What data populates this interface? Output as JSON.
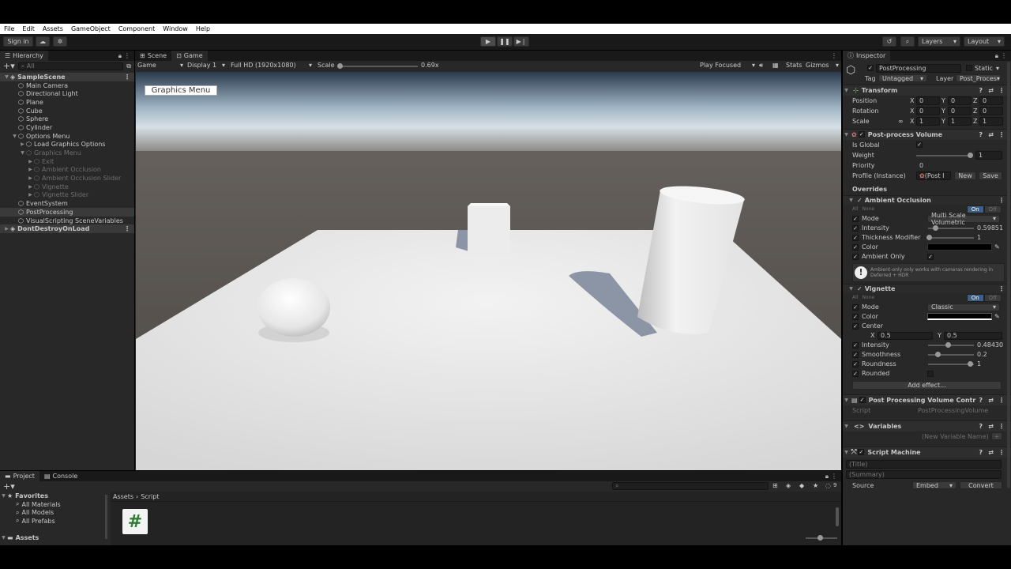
{
  "menu": [
    "File",
    "Edit",
    "Assets",
    "GameObject",
    "Component",
    "Window",
    "Help"
  ],
  "toolbar": {
    "sign_in": "Sign in",
    "layers": "Layers",
    "layout": "Layout"
  },
  "hierarchy": {
    "tab": "Hierarchy",
    "search_placeholder": "All",
    "rows": [
      {
        "label": "SampleScene",
        "depth": 0,
        "style": "scene"
      },
      {
        "label": "Main Camera",
        "depth": 1,
        "style": "normal"
      },
      {
        "label": "Directional Light",
        "depth": 1,
        "style": "normal"
      },
      {
        "label": "Plane",
        "depth": 1,
        "style": "normal"
      },
      {
        "label": "Cube",
        "depth": 1,
        "style": "normal"
      },
      {
        "label": "Sphere",
        "depth": 1,
        "style": "normal"
      },
      {
        "label": "Cylinder",
        "depth": 1,
        "style": "normal"
      },
      {
        "label": "Options Menu",
        "depth": 1,
        "style": "normal"
      },
      {
        "label": "Load Graphics Options",
        "depth": 2,
        "style": "normal"
      },
      {
        "label": "Graphics Menu",
        "depth": 2,
        "style": "dim"
      },
      {
        "label": "Exit",
        "depth": 3,
        "style": "dim"
      },
      {
        "label": "Ambient Occlusion",
        "depth": 3,
        "style": "dim"
      },
      {
        "label": "Ambient Occlusion Slider",
        "depth": 3,
        "style": "dim"
      },
      {
        "label": "Vignette",
        "depth": 3,
        "style": "dim"
      },
      {
        "label": "Vignette Slider",
        "depth": 3,
        "style": "dim"
      },
      {
        "label": "EventSystem",
        "depth": 1,
        "style": "normal"
      },
      {
        "label": "PostProcessing",
        "depth": 1,
        "style": "selected"
      },
      {
        "label": "VisualScripting SceneVariables",
        "depth": 1,
        "style": "normal"
      },
      {
        "label": "DontDestroyOnLoad",
        "depth": 0,
        "style": "scene"
      }
    ]
  },
  "game": {
    "tabs": [
      "Scene",
      "Game"
    ],
    "mode": "Game",
    "display": "Display 1",
    "resolution": "Full HD (1920x1080)",
    "scale_label": "Scale",
    "scale_value": "0.69x",
    "play_focused": "Play Focused",
    "stats": "Stats",
    "gizmos": "Gizmos",
    "ui_button": "Graphics Menu"
  },
  "inspector": {
    "tab": "Inspector",
    "object_name": "PostProcessing",
    "static_label": "Static",
    "tag_label": "Tag",
    "tag_value": "Untagged",
    "layer_label": "Layer",
    "layer_value": "Post_Proces",
    "transform": {
      "title": "Transform",
      "position_label": "Position",
      "rotation_label": "Rotation",
      "scale_label": "Scale",
      "position": [
        "0",
        "0",
        "0"
      ],
      "rotation": [
        "0",
        "0",
        "0"
      ],
      "scale": [
        "1",
        "1",
        "1"
      ]
    },
    "volume": {
      "title": "Post-process Volume",
      "is_global_label": "Is Global",
      "weight_label": "Weight",
      "weight_value": "1",
      "priority_label": "Priority",
      "priority_value": "0",
      "profile_label": "Profile (Instance)",
      "profile_value": "(Post I",
      "new_button": "New",
      "save_button": "Save",
      "overrides_label": "Overrides",
      "all_label": "All",
      "none_label": "None",
      "on_label": "On",
      "off_label": "Off"
    },
    "ao": {
      "title": "Ambient Occlusion",
      "mode_label": "Mode",
      "mode_value": "Multi Scale Volumetric",
      "intensity_label": "Intensity",
      "intensity_value": "0.59851",
      "thickness_label": "Thickness Modifier",
      "thickness_value": "1",
      "color_label": "Color",
      "ambient_only_label": "Ambient Only",
      "warning": "Ambient-only only works with cameras rendering in Deferred + HDR"
    },
    "vignette": {
      "title": "Vignette",
      "mode_label": "Mode",
      "mode_value": "Classic",
      "color_label": "Color",
      "center_label": "Center",
      "center_x": "0.5",
      "center_y": "0.5",
      "intensity_label": "Intensity",
      "intensity_value": "0.48430",
      "smoothness_label": "Smoothness",
      "smoothness_value": "0.2",
      "roundness_label": "Roundness",
      "roundness_value": "1",
      "rounded_label": "Rounded"
    },
    "add_effect": "Add effect...",
    "ppvc": {
      "title": "Post Processing Volume Contr",
      "script_label": "Script",
      "script_value": "PostProcessingVolume"
    },
    "variables": {
      "title": "Variables",
      "placeholder": "(New Variable Name)"
    },
    "script_machine": {
      "title": "Script Machine",
      "title_placeholder": "(Title)",
      "summary_placeholder": "(Summary)",
      "source_label": "Source",
      "source_value": "Embed",
      "convert_button": "Convert"
    }
  },
  "project": {
    "tabs": [
      "Project",
      "Console"
    ],
    "favorites": "Favorites",
    "fav_items": [
      "All Materials",
      "All Models",
      "All Prefabs"
    ],
    "assets": "Assets",
    "breadcrumb": [
      "Assets",
      "Script"
    ],
    "count": "9"
  },
  "colors": {
    "accent": "#3d5f86",
    "panel": "#282828",
    "dark": "#191919"
  }
}
